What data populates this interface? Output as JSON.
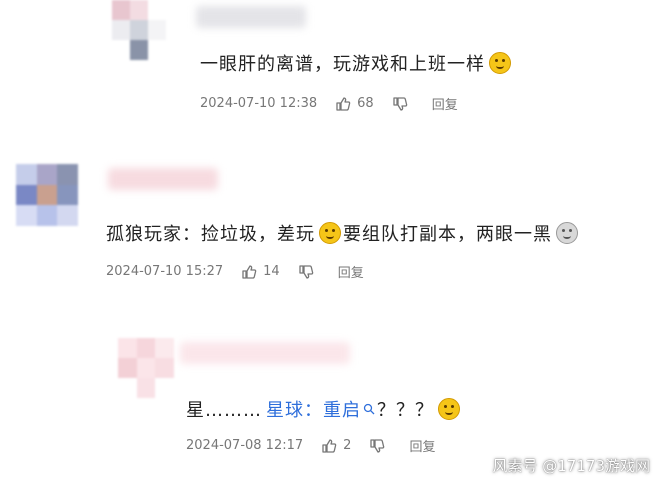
{
  "comments": [
    {
      "text": "一眼肝的离谱，玩游戏和上班一样",
      "time": "2024-07-10 12:38",
      "likes": "68",
      "reply_label": "回复",
      "emoji": "grinning-sweat-emoji"
    },
    {
      "text_before": "孤狼玩家：捡垃圾，差玩",
      "text_after": "要组队打副本，两眼一黑",
      "time": "2024-07-10 15:27",
      "likes": "14",
      "reply_label": "回复",
      "emojis": [
        "shocked-emoji",
        "dizzy-emoji"
      ]
    },
    {
      "text_prefix": "星………",
      "text_link": "星球：重启",
      "text_suffix": "？？？",
      "time": "2024-07-08 12:17",
      "likes": "2",
      "reply_label": "回复",
      "emoji": "awkward-emoji"
    }
  ],
  "icons": {
    "like": "thumbs-up-icon",
    "dislike": "thumbs-down-icon",
    "search": "search-icon"
  },
  "colors": {
    "link": "#2f6fdb",
    "meta": "#777777",
    "text": "#222222"
  },
  "watermark": "风素号 @17173游戏网"
}
